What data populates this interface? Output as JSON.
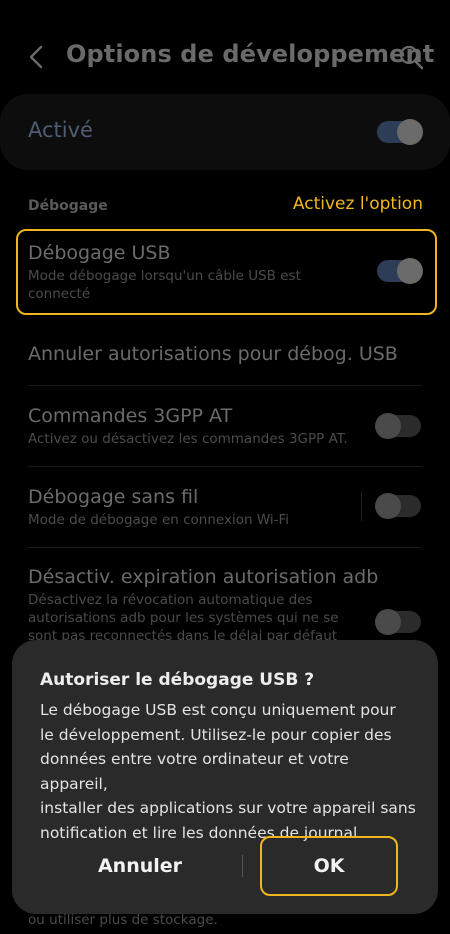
{
  "header": {
    "title": "Options de développement",
    "back_icon": "chevron-left-icon",
    "search_icon": "search-icon"
  },
  "master_switch": {
    "label": "Activé",
    "state": true
  },
  "section": {
    "title": "Débogage",
    "annotation": "Activez l'option"
  },
  "items": [
    {
      "title": "Débogage USB",
      "subtitle": "Mode débogage lorsqu'un câble USB est connecté",
      "toggle": true
    },
    {
      "title": "Annuler autorisations pour débog. USB"
    },
    {
      "title": "Commandes 3GPP AT",
      "subtitle": "Activez ou désactivez les commandes 3GPP AT.",
      "toggle": false
    },
    {
      "title": "Débogage sans fil",
      "subtitle": "Mode de débogage en connexion Wi-Fi",
      "toggle": false
    },
    {
      "title": "Désactiv. expiration autorisation adb",
      "subtitle": "Désactivez la révocation automatique des autorisations adb pour les systèmes qui ne se sont pas reconnectés dans le délai par défaut",
      "toggle": false
    }
  ],
  "peek_text": "ou utiliser plus de stockage.",
  "dialog": {
    "title": "Autoriser le débogage USB ?",
    "lines": [
      "Le débogage USB est conçu uniquement pour",
      "le développement. Utilisez-le pour copier des",
      "données entre votre ordinateur et votre appareil,",
      "installer des applications sur votre appareil sans",
      "notification et lire les données de journal."
    ],
    "cancel_label": "Annuler",
    "ok_label": "OK"
  },
  "colors": {
    "accent_highlight": "#efb51c",
    "annotation_text": "#f2b91d",
    "dialog_bg": "#2a2a2a",
    "toggle_on_track": "#2d3c57"
  }
}
